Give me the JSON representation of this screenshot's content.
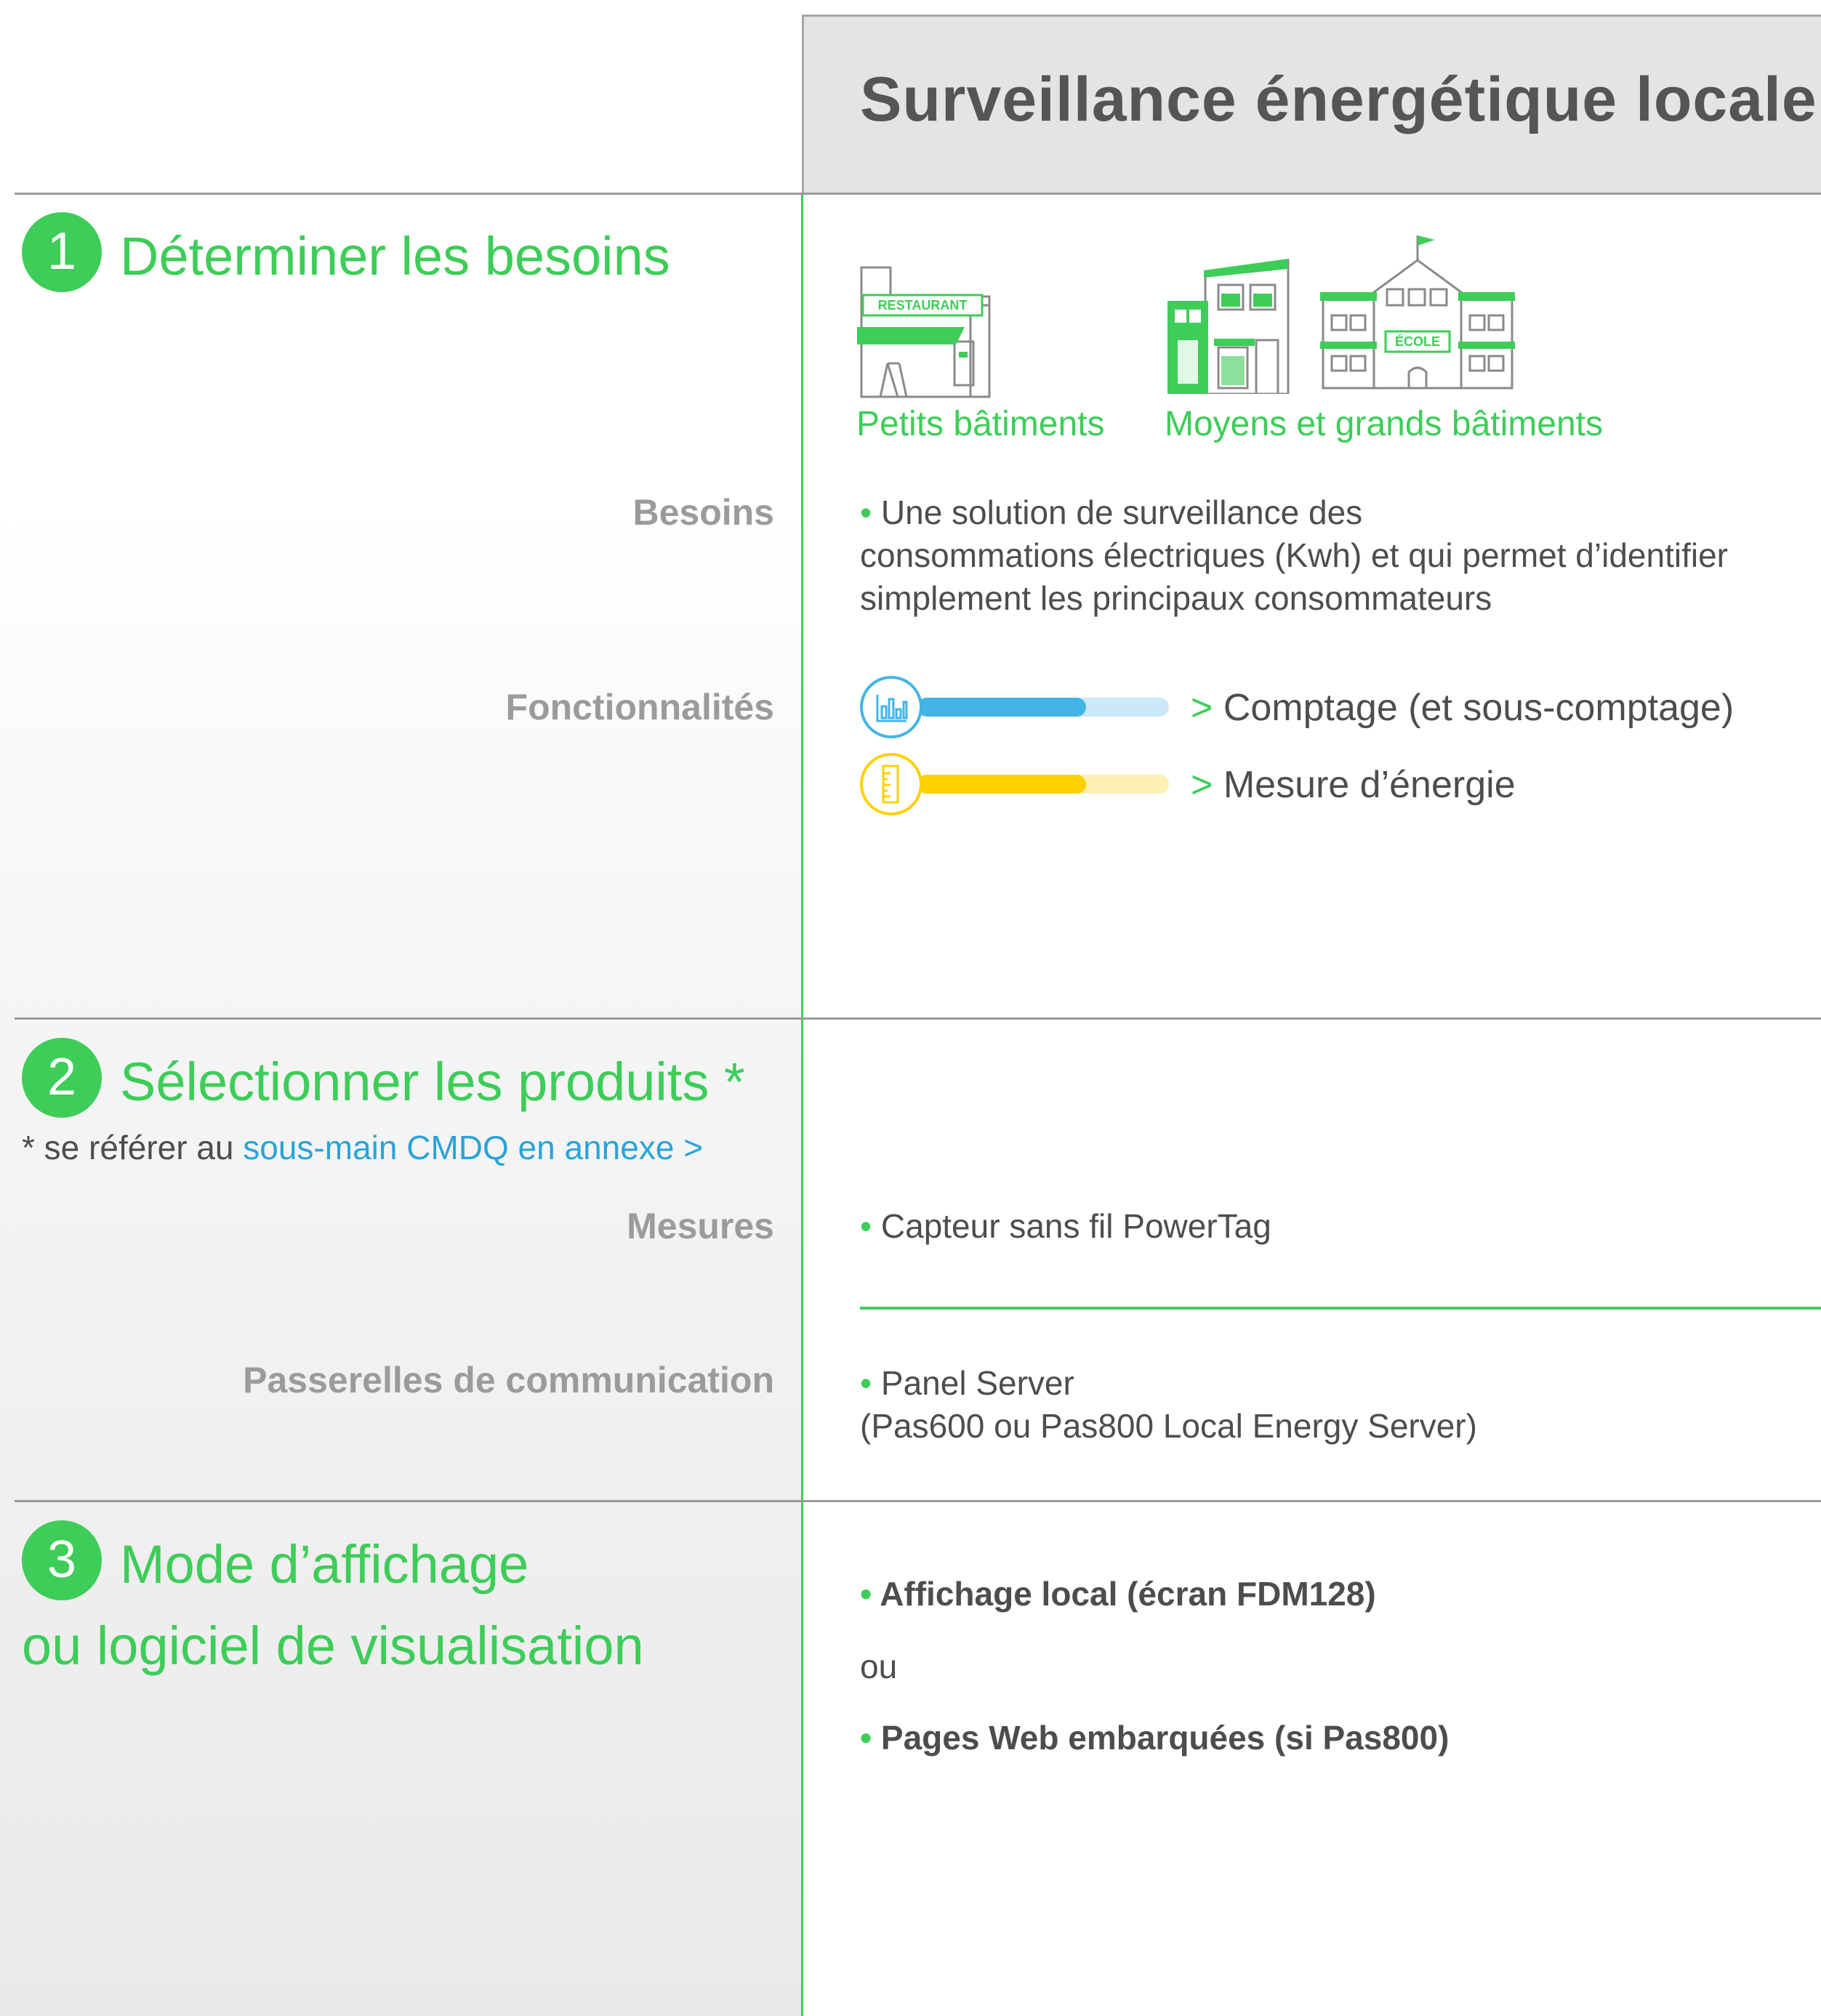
{
  "header": {
    "title": "Surveillance énergétique locale"
  },
  "sections": {
    "s1": {
      "number": "1",
      "title": "Déterminer les besoins"
    },
    "s2": {
      "number": "2",
      "title": "Sélectionner les produits *"
    },
    "s3": {
      "number": "3",
      "title_line1": "Mode d’affichage",
      "title_line2": "ou logiciel de visualisation"
    }
  },
  "buildings": {
    "small_caption": "Petits bâtiments",
    "large_caption": "Moyens et grands bâtiments",
    "restaurant_sign": "RESTAURANT",
    "school_sign": "ÉCOLE"
  },
  "labels": {
    "besoins": "Besoins",
    "fonctionnalites": "Fonctionnalités",
    "mesures": "Mesures",
    "passerelles": "Passerelles de communication"
  },
  "besoins": {
    "bullet": "•",
    "line1": "Une solution de surveillance des",
    "line2": "consommations électriques (Kwh) et qui permet d’identifier",
    "line3": "simplement les principaux consommateurs"
  },
  "functions": [
    {
      "prefix": ">",
      "label": "Comptage (et sous-comptage)",
      "level": 0.67,
      "color": "#42b4e6",
      "track_color": "#cbe9f7",
      "icon": "bar-chart-icon"
    },
    {
      "prefix": ">",
      "label": "Mesure d’énergie",
      "level": 0.67,
      "color": "#ffd100",
      "track_color": "#fff0b3",
      "icon": "ruler-icon"
    }
  ],
  "note": {
    "prefix": "* se référer au ",
    "link": "sous-main CMDQ en annexe >"
  },
  "mesures": {
    "bullet": "•",
    "text": "Capteur sans fil PowerTag"
  },
  "passerelles": {
    "bullet": "•",
    "line1": "Panel Server",
    "line2": "(Pas600 ou Pas800 Local Energy Server)"
  },
  "affichage": {
    "bullet": "•",
    "option1": "Affichage local (écran FDM128)",
    "or": "ou",
    "option2": "Pages Web embarquées (si Pas800)"
  },
  "colors": {
    "green": "#3dcd58",
    "blue_link": "#2aa3d8",
    "gray_text": "#9b9b9b"
  }
}
